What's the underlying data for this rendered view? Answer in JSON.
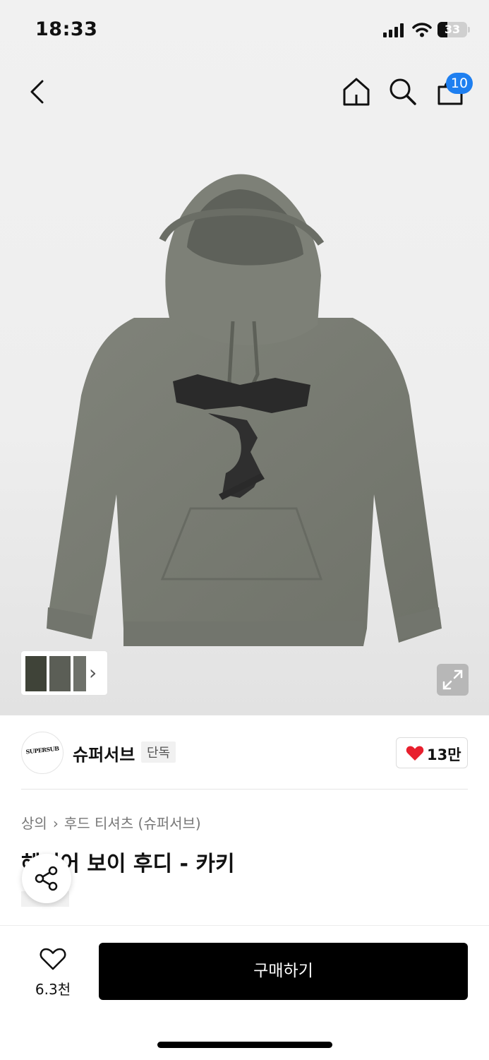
{
  "status": {
    "time": "18:33",
    "battery": "33",
    "battery_level": 0.33
  },
  "nav": {
    "cart_count": "10"
  },
  "gallery": {
    "thumb_more": "›"
  },
  "brand": {
    "logo_text": "SUPERSUB",
    "name": "슈퍼서브",
    "tag": "단독",
    "likes": "13만"
  },
  "product": {
    "breadcrumb": [
      "상의",
      "후드 티셔츠 (슈퍼서브)"
    ],
    "breadcrumb_sep": "›",
    "title": "헤리어 보이 후디 - 카키"
  },
  "bottom": {
    "wish_count": "6.3천",
    "buy_label": "구매하기"
  },
  "colors": {
    "hoodie": "#7a7d75",
    "badge": "#1e7ff0",
    "heart": "#e8202e",
    "buy": "#000000"
  }
}
